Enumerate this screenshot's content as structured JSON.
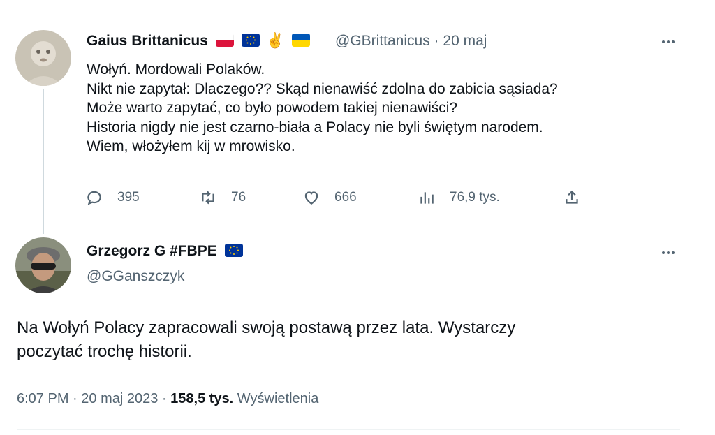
{
  "parent_tweet": {
    "display_name": "Gaius Brittanicus",
    "emoji": "✌️",
    "handle": "@GBrittanicus",
    "separator": "·",
    "date": "20 maj",
    "text_lines": [
      "Wołyń. Mordowali Polaków.",
      "Nikt nie zapytał: Dlaczego?? Skąd nienawiść zdolna do zabicia sąsiada?",
      "Może warto zapytać, co było powodem takiej nienawiści?",
      "Historia nigdy nie jest czarno-biała a Polacy nie byli świętym narodem.",
      "Wiem, włożyłem kij w mrowisko."
    ],
    "stats": {
      "replies": "395",
      "retweets": "76",
      "likes": "666",
      "views": "76,9 tys."
    }
  },
  "main_tweet": {
    "display_name": "Grzegorz G #FBPE",
    "handle": "@GGanszczyk",
    "text_lines": [
      "Na Wołyń Polacy zapracowali swoją postawą przez lata. Wystarczy",
      "poczytać trochę historii."
    ],
    "time": "6:07 PM",
    "separator": "·",
    "date": "20 maj 2023",
    "views_count": "158,5 tys.",
    "views_label": "Wyświetlenia"
  },
  "colors": {
    "text": "#0f1419",
    "secondary": "#536471",
    "thread_line": "#cfd9de",
    "eu_blue": "#003399",
    "eu_gold": "#ffcc00",
    "pl_red": "#dc143c",
    "ua_blue": "#0057b7",
    "ua_yellow": "#ffd700"
  },
  "icons": [
    "more-icon",
    "reply-icon",
    "retweet-icon",
    "like-icon",
    "views-icon",
    "share-icon",
    "flag-poland-icon",
    "flag-eu-icon",
    "flag-ukraine-icon"
  ]
}
